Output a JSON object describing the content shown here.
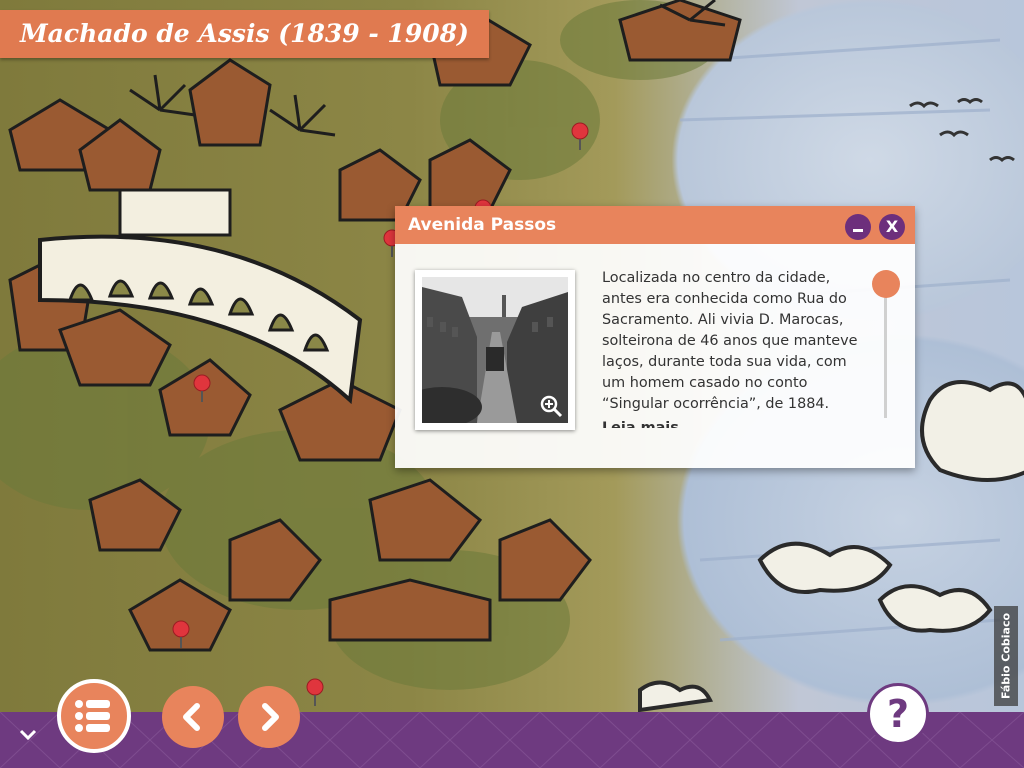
{
  "title": "Machado de Assis (1839 - 1908)",
  "credit": "Fábio Cobiaco",
  "popup": {
    "title": "Avenida Passos",
    "description": "Localizada no centro da cidade, antes era conhecida como Rua do Sacramento. Ali vivia D. Marocas, solteirona de 46 anos que manteve laços, durante toda sua vida, com um homem casado no conto “Singular ocorrência”, de 1884.",
    "read_more": "Leia mais",
    "close_label": "X",
    "photo_icon": "zoom-in-icon"
  },
  "nav": {
    "menu_icon": "list-icon",
    "prev_icon": "chevron-left-icon",
    "next_icon": "chevron-right-icon",
    "help_label": "?",
    "collapse_icon": "chevron-down-icon"
  },
  "colors": {
    "accent": "#e8845c",
    "title_bg": "#e07a50",
    "bar": "#6e3a80",
    "pin": "#e0353d"
  }
}
